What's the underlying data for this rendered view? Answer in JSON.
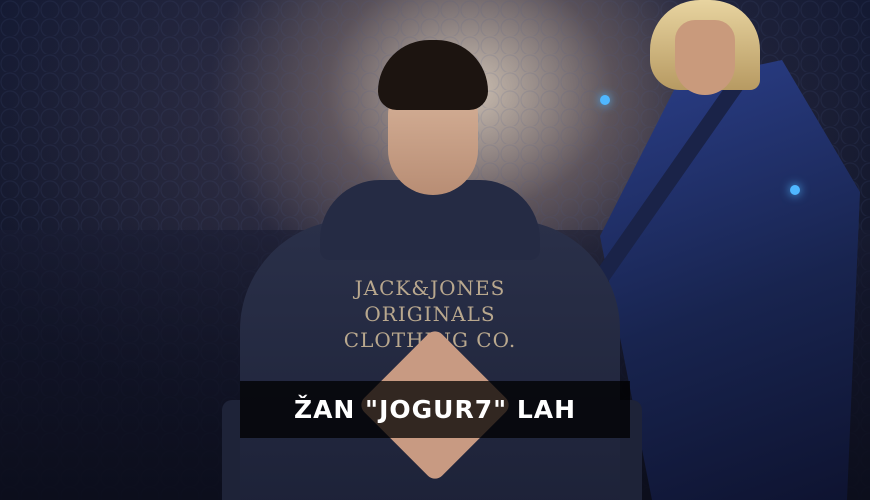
{
  "caption": {
    "name": "ŽAN \"JOGUR7\" LAH"
  },
  "hoodie_print": {
    "line1": "JACK&JONES",
    "line2": "ORIGINALS",
    "line3": "CLOTHING CO."
  },
  "colors": {
    "background": "#0b0f1e",
    "caption_bg": "#000000",
    "caption_text": "#ffffff",
    "accent_blue": "#4fb7ff"
  }
}
